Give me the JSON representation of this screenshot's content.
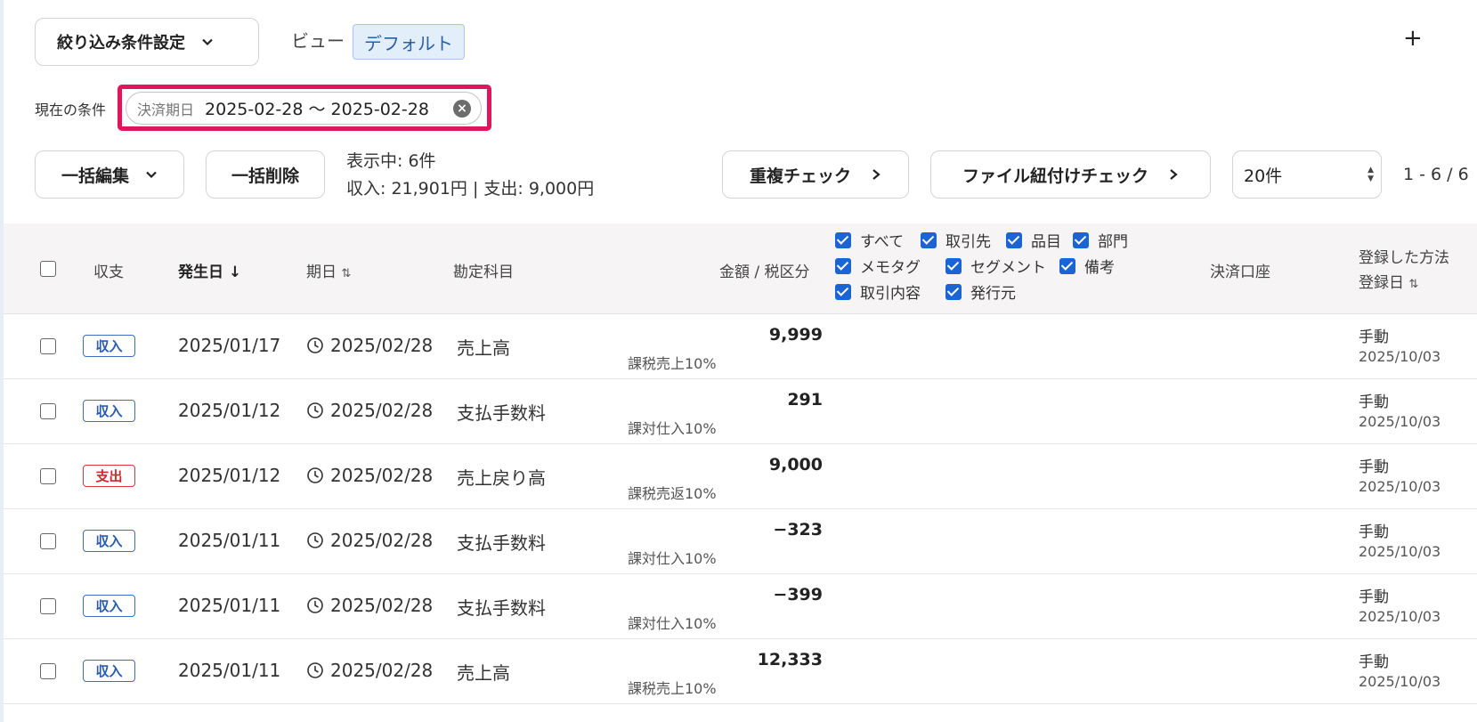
{
  "toolbar": {
    "filter_button": "絞り込み条件設定",
    "view_label": "ビュー",
    "view_value": "デフォルト",
    "add": "+"
  },
  "condition": {
    "label": "現在の条件",
    "key": "決済期日",
    "value": "2025-02-28 〜 2025-02-28",
    "highlight_color": "#e0155c"
  },
  "actions": {
    "bulk_edit": "一括編集",
    "bulk_delete": "一括削除",
    "showing": "表示中: 6件",
    "totals": "収入: 21,901円 | 支出: 9,000円",
    "dup_check": "重複チェック",
    "file_check": "ファイル紐付けチェック",
    "per_page": "20件",
    "range": "1 - 6 / 6"
  },
  "columns": {
    "type": "収支",
    "occurred": "発生日",
    "due": "期日",
    "account": "勘定科目",
    "amount": "金額 / 税区分",
    "settlement_account": "決済口座",
    "reg_method": "登録した方法",
    "reg_date": "登録日",
    "options": [
      "すべて",
      "取引先",
      "品目",
      "部門",
      "メモタグ",
      "セグメント",
      "備考",
      "取引内容",
      "発行元"
    ]
  },
  "rows": [
    {
      "type": "収入",
      "kind": "income",
      "date": "2025/01/17",
      "due": "2025/02/28",
      "account": "売上高",
      "amount": "9,999",
      "tax": "課税売上10%",
      "method": "手動",
      "regdate": "2025/10/03"
    },
    {
      "type": "収入",
      "kind": "income",
      "date": "2025/01/12",
      "due": "2025/02/28",
      "account": "支払手数料",
      "amount": "291",
      "tax": "課対仕入10%",
      "method": "手動",
      "regdate": "2025/10/03"
    },
    {
      "type": "支出",
      "kind": "expense",
      "date": "2025/01/12",
      "due": "2025/02/28",
      "account": "売上戻り高",
      "amount": "9,000",
      "tax": "課税売返10%",
      "method": "手動",
      "regdate": "2025/10/03"
    },
    {
      "type": "収入",
      "kind": "income",
      "date": "2025/01/11",
      "due": "2025/02/28",
      "account": "支払手数料",
      "amount": "−323",
      "tax": "課対仕入10%",
      "method": "手動",
      "regdate": "2025/10/03"
    },
    {
      "type": "収入",
      "kind": "income",
      "date": "2025/01/11",
      "due": "2025/02/28",
      "account": "支払手数料",
      "amount": "−399",
      "tax": "課対仕入10%",
      "method": "手動",
      "regdate": "2025/10/03"
    },
    {
      "type": "収入",
      "kind": "income",
      "date": "2025/01/11",
      "due": "2025/02/28",
      "account": "売上高",
      "amount": "12,333",
      "tax": "課税売上10%",
      "method": "手動",
      "regdate": "2025/10/03"
    }
  ]
}
